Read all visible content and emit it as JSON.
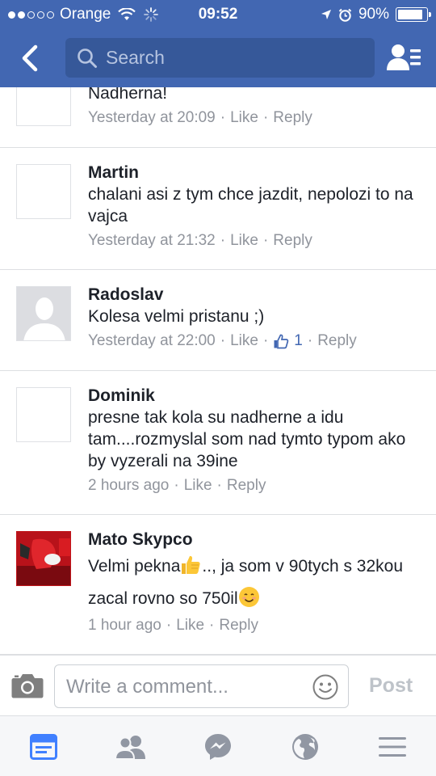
{
  "status_bar": {
    "carrier": "Orange",
    "time": "09:52",
    "battery": "90%",
    "battery_level": 0.9
  },
  "header": {
    "search_placeholder": "Search"
  },
  "comments": [
    {
      "author": "",
      "text": "Nadherna!",
      "time": "Yesterday at 20:09",
      "like": "Like",
      "reply": "Reply",
      "likes_count": ""
    },
    {
      "author": "Martin",
      "text": "chalani asi z tym chce jazdit, nepolozi to na vajca",
      "time": "Yesterday at 21:32",
      "like": "Like",
      "reply": "Reply",
      "likes_count": ""
    },
    {
      "author": "Radoslav",
      "text": "Kolesa velmi pristanu ;)",
      "time": "Yesterday at 22:00",
      "like": "Like",
      "reply": "Reply",
      "likes_count": "1"
    },
    {
      "author": "Dominik",
      "text": "presne tak kola su nadherne a idu tam....rozmyslal som nad tymto typom ako by vyzerali na 39ine",
      "time": "2 hours ago",
      "like": "Like",
      "reply": "Reply",
      "likes_count": ""
    },
    {
      "author": "Mato Skypco",
      "text_part1": "Velmi pekna",
      "text_part2": ".., ja som v 90tych s 32kou zacal rovno so 750il",
      "time": "1 hour ago",
      "like": "Like",
      "reply": "Reply",
      "likes_count": ""
    }
  ],
  "composer": {
    "placeholder": "Write a comment...",
    "post_label": "Post"
  },
  "tabbar": {
    "active_tab": "news-feed",
    "tabs": [
      "news-feed-icon",
      "friend-requests-icon",
      "messenger-icon",
      "notifications-globe-icon",
      "menu-icon"
    ]
  },
  "colors": {
    "brand": "#4267b2",
    "search_bg": "#365899",
    "meta_text": "#90949c",
    "active_tab": "#4080ff",
    "inactive_tab": "#9197a3",
    "post_disabled": "#bec3c9"
  }
}
